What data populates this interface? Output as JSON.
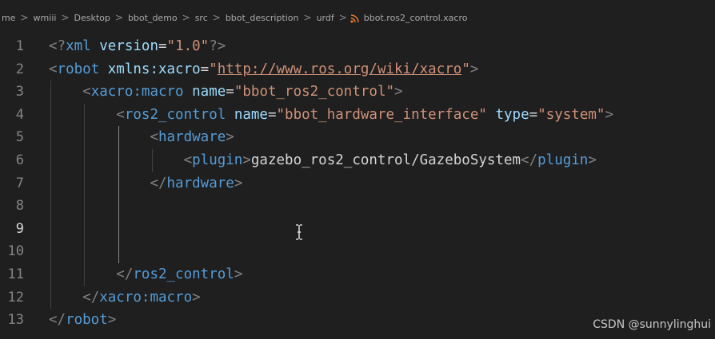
{
  "breadcrumb": {
    "items": [
      "me",
      "wmiii",
      "Desktop",
      "bbot_demo",
      "src",
      "bbot_description",
      "urdf"
    ],
    "file": "bbot.ros2_control.xacro",
    "separator": ">"
  },
  "editor": {
    "active_line": 9,
    "lines": [
      {
        "n": "1",
        "tokens": [
          {
            "c": "t-punc",
            "v": "<?"
          },
          {
            "c": "t-pi",
            "v": "xml"
          },
          {
            "c": "t-attr",
            "v": " version"
          },
          {
            "c": "t-eq",
            "v": "="
          },
          {
            "c": "t-str",
            "v": "\"1.0\""
          },
          {
            "c": "t-punc",
            "v": "?>"
          }
        ]
      },
      {
        "n": "2",
        "tokens": [
          {
            "c": "t-punc",
            "v": "<"
          },
          {
            "c": "t-tag",
            "v": "robot"
          },
          {
            "c": "t-attr",
            "v": " xmlns:xacro"
          },
          {
            "c": "t-eq",
            "v": "="
          },
          {
            "c": "t-str",
            "v": "\""
          },
          {
            "c": "t-url",
            "v": "http://www.ros.org/wiki/xacro"
          },
          {
            "c": "t-str",
            "v": "\""
          },
          {
            "c": "t-punc",
            "v": ">"
          }
        ]
      },
      {
        "n": "3",
        "tokens": [
          {
            "c": "t-text",
            "v": "    "
          },
          {
            "c": "t-punc",
            "v": "<"
          },
          {
            "c": "t-tag",
            "v": "xacro:macro"
          },
          {
            "c": "t-attr",
            "v": " name"
          },
          {
            "c": "t-eq",
            "v": "="
          },
          {
            "c": "t-str",
            "v": "\"bbot_ros2_control\""
          },
          {
            "c": "t-punc",
            "v": ">"
          }
        ]
      },
      {
        "n": "4",
        "tokens": [
          {
            "c": "t-text",
            "v": "        "
          },
          {
            "c": "t-punc",
            "v": "<"
          },
          {
            "c": "t-tag",
            "v": "ros2_control"
          },
          {
            "c": "t-attr",
            "v": " name"
          },
          {
            "c": "t-eq",
            "v": "="
          },
          {
            "c": "t-str",
            "v": "\"bbot_hardware_interface\""
          },
          {
            "c": "t-attr",
            "v": " type"
          },
          {
            "c": "t-eq",
            "v": "="
          },
          {
            "c": "t-str",
            "v": "\"system\""
          },
          {
            "c": "t-punc",
            "v": ">"
          }
        ]
      },
      {
        "n": "5",
        "tokens": [
          {
            "c": "t-text",
            "v": "            "
          },
          {
            "c": "t-punc",
            "v": "<"
          },
          {
            "c": "t-tag",
            "v": "hardware"
          },
          {
            "c": "t-punc",
            "v": ">"
          }
        ]
      },
      {
        "n": "6",
        "tokens": [
          {
            "c": "t-text",
            "v": "                "
          },
          {
            "c": "t-punc",
            "v": "<"
          },
          {
            "c": "t-tag",
            "v": "plugin"
          },
          {
            "c": "t-punc",
            "v": ">"
          },
          {
            "c": "t-text",
            "v": "gazebo_ros2_control/GazeboSystem"
          },
          {
            "c": "t-punc",
            "v": "</"
          },
          {
            "c": "t-tag",
            "v": "plugin"
          },
          {
            "c": "t-punc",
            "v": ">"
          }
        ]
      },
      {
        "n": "7",
        "tokens": [
          {
            "c": "t-text",
            "v": "            "
          },
          {
            "c": "t-punc",
            "v": "</"
          },
          {
            "c": "t-tag",
            "v": "hardware"
          },
          {
            "c": "t-punc",
            "v": ">"
          }
        ]
      },
      {
        "n": "8",
        "tokens": []
      },
      {
        "n": "9",
        "tokens": []
      },
      {
        "n": "10",
        "tokens": []
      },
      {
        "n": "11",
        "tokens": [
          {
            "c": "t-text",
            "v": "        "
          },
          {
            "c": "t-punc",
            "v": "</"
          },
          {
            "c": "t-tag",
            "v": "ros2_control"
          },
          {
            "c": "t-punc",
            "v": ">"
          }
        ]
      },
      {
        "n": "12",
        "tokens": [
          {
            "c": "t-text",
            "v": "    "
          },
          {
            "c": "t-punc",
            "v": "</"
          },
          {
            "c": "t-tag",
            "v": "xacro:macro"
          },
          {
            "c": "t-punc",
            "v": ">"
          }
        ]
      },
      {
        "n": "13",
        "tokens": [
          {
            "c": "t-punc",
            "v": "</"
          },
          {
            "c": "t-tag",
            "v": "robot"
          },
          {
            "c": "t-punc",
            "v": ">"
          }
        ]
      }
    ]
  },
  "watermark": "CSDN @sunnylinghui",
  "colors": {
    "background": "#1f1f1f",
    "tag": "#569cd6",
    "attribute": "#9cdcfe",
    "string": "#ce9178",
    "punctuation": "#808080",
    "text": "#d4d4d4",
    "line_number": "#858585",
    "file_icon": "#e37933"
  },
  "icons": {
    "file_icon": "rss-icon",
    "mouse_cursor": "text-cursor-icon"
  }
}
